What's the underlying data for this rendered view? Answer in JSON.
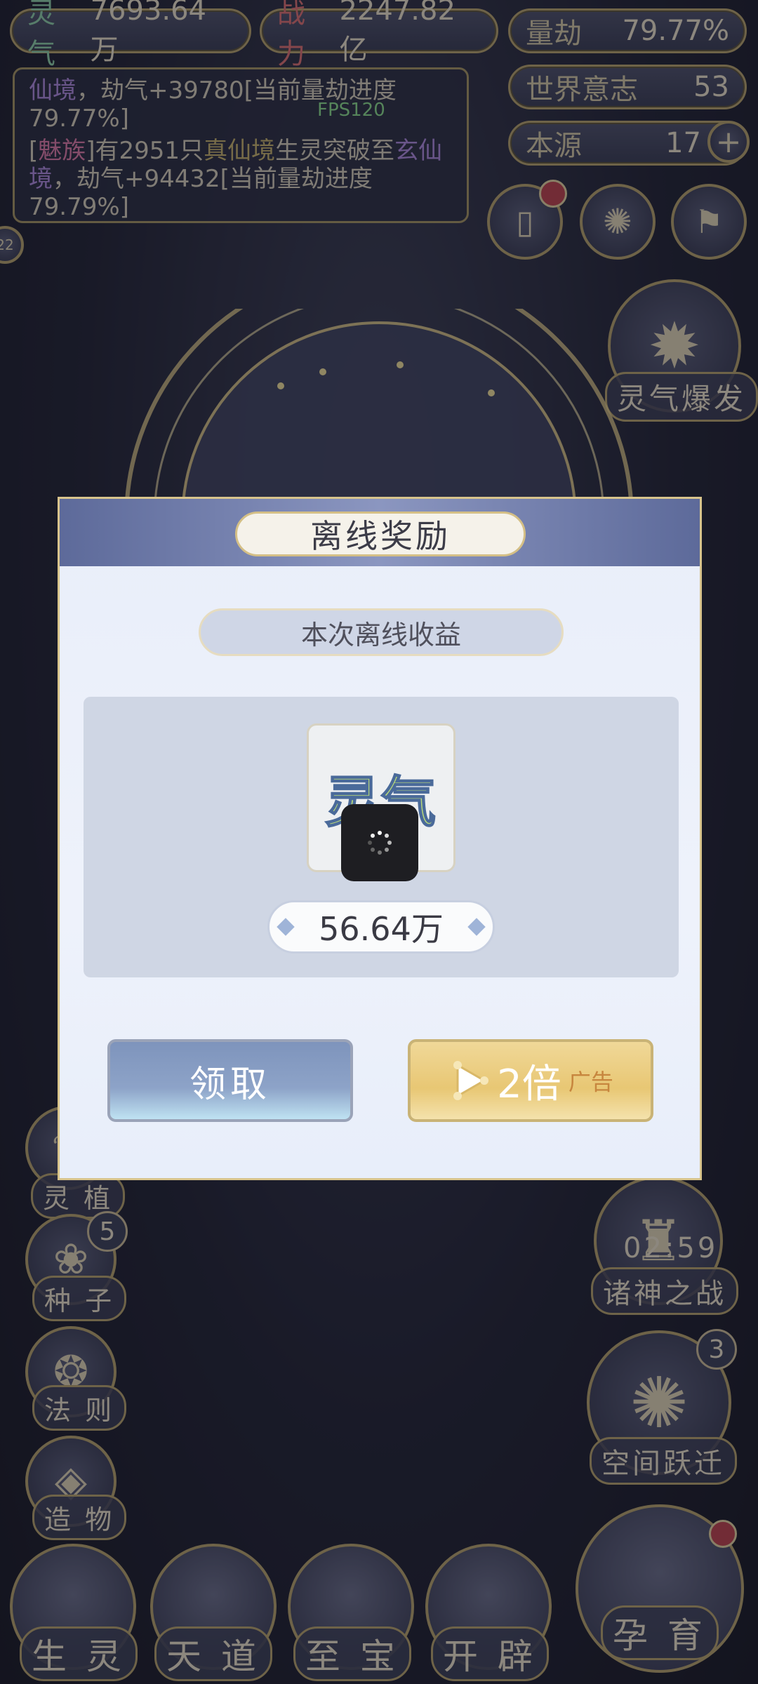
{
  "top": {
    "lingqi_label": "灵气",
    "lingqi_value": "7693.64万",
    "zhanli_label": "战力",
    "zhanli_value": "2247.82亿",
    "liangjie_label": "量劫",
    "liangjie_value": "79.77%",
    "shijie_label": "世界意志",
    "shijie_value": "53",
    "benyuan_label": "本源",
    "benyuan_value": "17"
  },
  "log": {
    "line1_a": "仙境",
    "line1_b": "，劫气+39780[当前量劫进度79.77%]",
    "line2_open": "[",
    "line2_clan": "魅族",
    "line2_mid": "]有2951只",
    "line2_realm": "真仙境",
    "line2_mid2": "生灵突破至",
    "line2_target": "玄仙境",
    "line2_end": "，劫气+94432[当前量劫进度79.79%]"
  },
  "fps": "FPS120",
  "side_left_badge": "22",
  "lingqi_burst_label": "灵气爆发",
  "left_menu": {
    "lingzhi": "灵 植",
    "zhongzi": "种 子",
    "zhongzi_badge": "5",
    "faze": "法 则",
    "zaowu": "造 物"
  },
  "right_menu": {
    "zhuzhen_timer": "02:59",
    "zhuzhen": "诸神之战",
    "kongjian": "空间跃迁",
    "kongjian_badge": "3"
  },
  "bottom_nav": {
    "shengling": "生 灵",
    "tiandao": "天 道",
    "zhibao": "至 宝",
    "kaipi": "开 辟",
    "yunyu": "孕 育"
  },
  "dialog": {
    "title": "离线奖励",
    "subtitle": "本次离线收益",
    "item_name": "灵气",
    "amount": "56.64万",
    "claim_label": "领取",
    "double_label": "2倍",
    "ad_label": "广告"
  }
}
